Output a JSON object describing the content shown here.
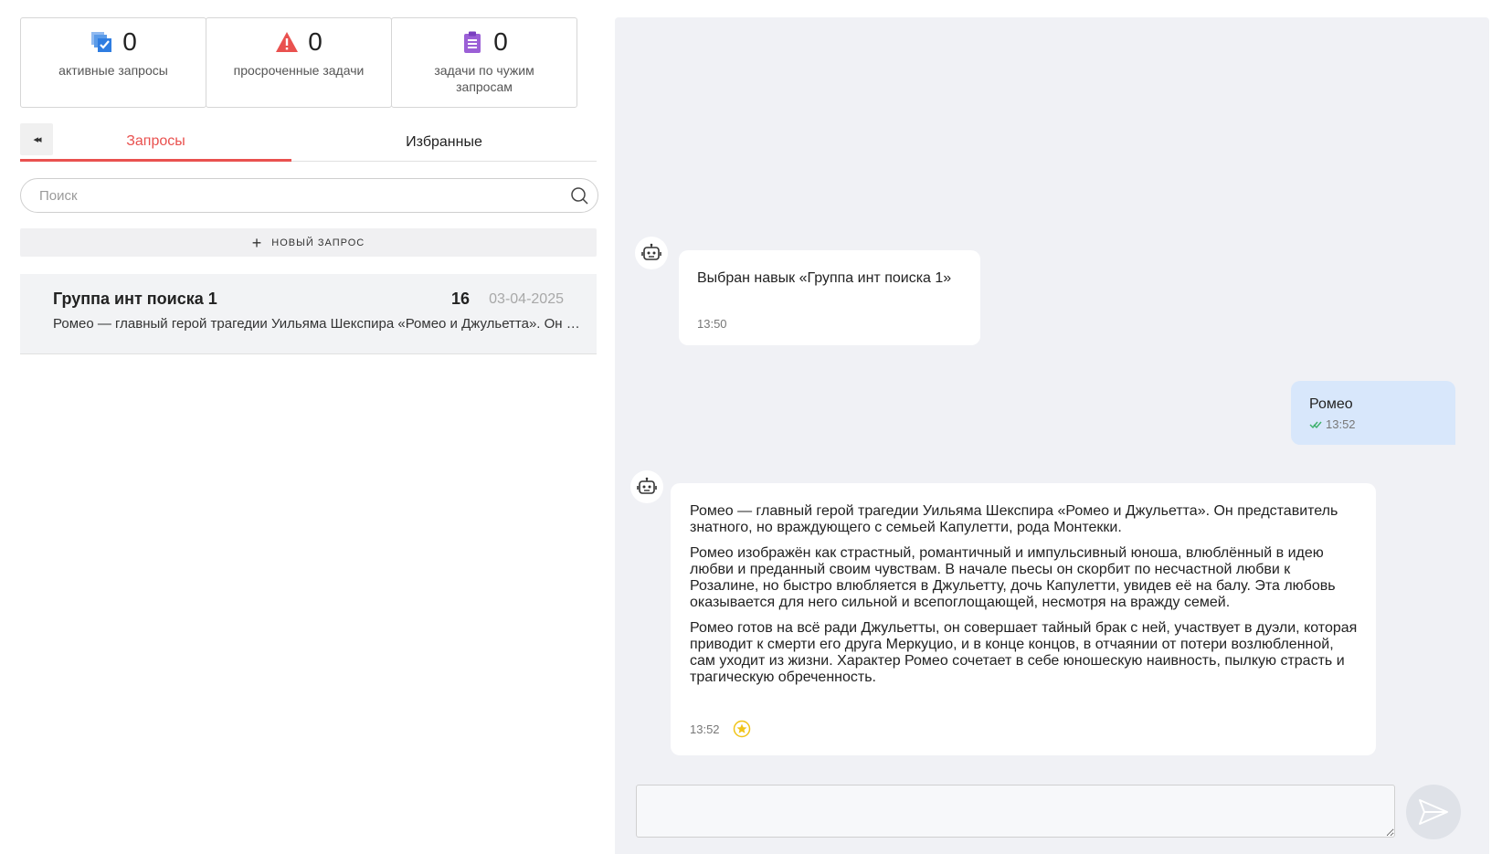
{
  "stats": [
    {
      "value": "0",
      "label": "активные запросы",
      "icon": "stacked-check-icon",
      "color": "#2f7de1"
    },
    {
      "value": "0",
      "label": "просроченные задачи",
      "icon": "warning-triangle-icon",
      "color": "#e9514f"
    },
    {
      "value": "0",
      "label": "задачи по чужим запросам",
      "icon": "clipboard-icon",
      "color": "#9b5fd6"
    }
  ],
  "tabs": {
    "collapse": "◂◂",
    "requests": "Запросы",
    "favorites": "Избранные"
  },
  "search": {
    "placeholder": "Поиск"
  },
  "new_request": {
    "label": "НОВЫЙ ЗАПРОС",
    "icon": "+"
  },
  "requests": [
    {
      "title": "Группа инт поиска 1",
      "count": "16",
      "date": "03-04-2025",
      "preview": "Ромео — главный герой трагедии Уильяма Шекспира «Ромео и Джульетта». Он представитель знатного, но враждующего с семьей Капулетти, рода Монтекки."
    }
  ],
  "chat": {
    "messages": [
      {
        "from": "bot",
        "text": "Выбран навык «Группа инт поиска 1»",
        "time": "13:50"
      },
      {
        "from": "user",
        "text": "Ромео",
        "time": "13:52",
        "status": "delivered"
      },
      {
        "from": "bot",
        "paragraphs": [
          "Ромео — главный герой трагедии Уильяма Шекспира «Ромео и Джульетта». Он представитель знатного, но враждующего с семьей Капулетти, рода Монтекки.",
          "Ромео изображён как страстный, романтичный и импульсивный юноша, влюблённый в идею любви и преданный своим чувствам. В начале пьесы он скорбит по несчастной любви к Розалине, но быстро влюбляется в Джульетту, дочь Капулетти, увидев её на балу. Эта любовь оказывается для него сильной и всепоглощающей, несмотря на вражду семей.",
          "Ромео готов на всё ради Джульетты, он совершает тайный брак с ней, участвует в дуэли, которая приводит к смерти его друга Меркуцио, и в конце концов, в отчаянии от потери возлюбленной, сам уходит из жизни. Характер Ромео сочетает в себе юношескую наивность, пылкую страсть и трагическую обреченность."
        ],
        "time": "13:52",
        "icon": "star-icon"
      }
    ],
    "composer": {
      "value": "",
      "send_icon": "send-icon"
    }
  },
  "colors": {
    "accent": "#e9514f",
    "chat_bg": "#f0f1f5",
    "user_bubble": "#d8e7fb",
    "star": "#f0c419",
    "check": "#3bb06a"
  }
}
